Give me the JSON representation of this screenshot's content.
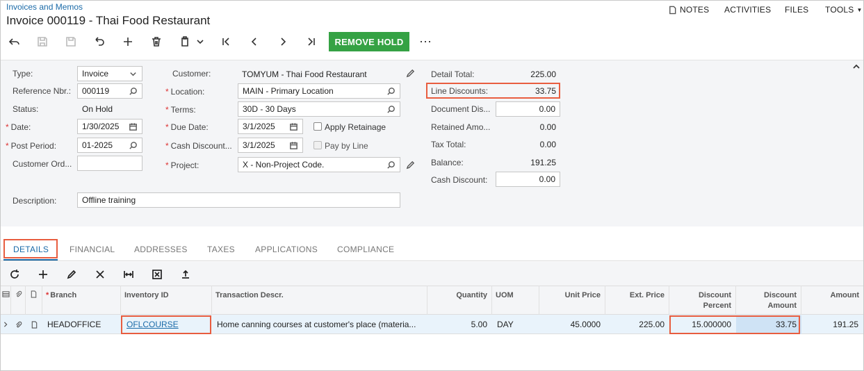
{
  "header": {
    "breadcrumb": "Invoices and Memos",
    "title": "Invoice 000119 - Thai Food Restaurant",
    "menu": {
      "notes": "NOTES",
      "activities": "ACTIVITIES",
      "files": "FILES",
      "tools": "TOOLS"
    }
  },
  "toolbar": {
    "icons": [
      "back-icon",
      "save-close-icon",
      "save-icon",
      "undo-icon",
      "add-icon",
      "delete-icon",
      "copy-paste-icon",
      "first-icon",
      "previous-icon",
      "next-icon",
      "last-icon"
    ],
    "remove_hold": "REMOVE HOLD",
    "more": "⋯",
    "accent": "#35a244"
  },
  "form": {
    "type_label": "Type:",
    "type_value": "Invoice",
    "ref_label": "Reference Nbr.:",
    "ref_value": "000119",
    "status_label": "Status:",
    "status_value": "On Hold",
    "date_label": "Date:",
    "date_value": "1/30/2025",
    "period_label": "Post Period:",
    "period_value": "01-2025",
    "custord_label": "Customer Ord...",
    "custord_value": "",
    "customer_label": "Customer:",
    "customer_value": "TOMYUM - Thai Food Restaurant",
    "location_label": "Location:",
    "location_value": "MAIN - Primary Location",
    "terms_label": "Terms:",
    "terms_value": "30D - 30 Days",
    "duedate_label": "Due Date:",
    "duedate_value": "3/1/2025",
    "cashdisc_label": "Cash Discount...",
    "cashdisc_value": "3/1/2025",
    "project_label": "Project:",
    "project_value": "X - Non-Project Code.",
    "apply_retainage": "Apply Retainage",
    "pay_by_line": "Pay by Line",
    "description_label": "Description:",
    "description_value": "Offline training"
  },
  "totals": {
    "detail_total_label": "Detail Total:",
    "detail_total": "225.00",
    "line_discounts_label": "Line Discounts:",
    "line_discounts": "33.75",
    "doc_discount_label": "Document Dis...",
    "doc_discount": "0.00",
    "retained_label": "Retained Amo...",
    "retained": "0.00",
    "tax_total_label": "Tax Total:",
    "tax_total": "0.00",
    "balance_label": "Balance:",
    "balance": "191.25",
    "cash_discount_label": "Cash Discount:",
    "cash_discount": "0.00"
  },
  "tabs": [
    "DETAILS",
    "FINANCIAL",
    "ADDRESSES",
    "TAXES",
    "APPLICATIONS",
    "COMPLIANCE"
  ],
  "grid": {
    "columns": {
      "branch": "Branch",
      "inventory_id": "Inventory ID",
      "transaction_descr": "Transaction Descr.",
      "quantity": "Quantity",
      "uom": "UOM",
      "unit_price": "Unit Price",
      "ext_price": "Ext. Price",
      "discount_percent_1": "Discount",
      "discount_percent_2": "Percent",
      "discount_amount_1": "Discount",
      "discount_amount_2": "Amount",
      "amount": "Amount"
    },
    "rows": [
      {
        "branch": "HEADOFFICE",
        "inventory_id": "OFLCOURSE",
        "transaction_descr": "Home canning courses at customer's place (materia...",
        "quantity": "5.00",
        "uom": "DAY",
        "unit_price": "45.0000",
        "ext_price": "225.00",
        "discount_percent": "15.000000",
        "discount_amount": "33.75",
        "amount": "191.25"
      }
    ]
  },
  "colors": {
    "highlight": "#e85d3f",
    "link": "#1a6aa8",
    "row_selected": "#e9f3fb"
  }
}
